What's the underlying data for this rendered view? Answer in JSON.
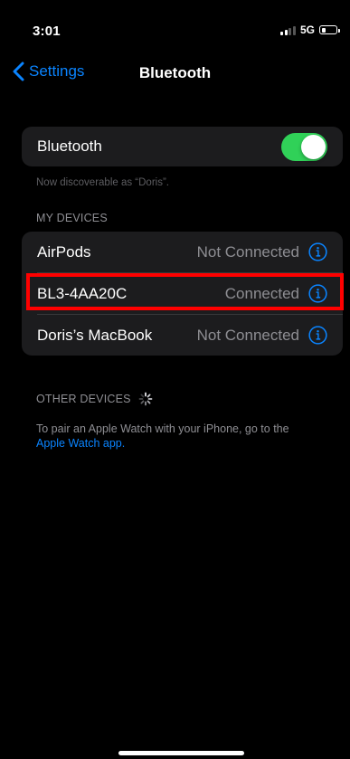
{
  "status_bar": {
    "time": "3:01",
    "network": "5G",
    "battery_level": 0.35
  },
  "nav": {
    "back_label": "Settings",
    "title": "Bluetooth"
  },
  "bluetooth_toggle": {
    "label": "Bluetooth",
    "on": true
  },
  "discoverable_text": "Now discoverable as “Doris”.",
  "my_devices": {
    "header": "MY DEVICES",
    "devices": [
      {
        "name": "AirPods",
        "status": "Not Connected"
      },
      {
        "name": "BL3-4AA20C",
        "status": "Connected"
      },
      {
        "name": "Doris’s MacBook",
        "status": "Not Connected"
      }
    ]
  },
  "other_devices": {
    "header": "OTHER DEVICES",
    "pair_text": "To pair an Apple Watch with your iPhone, go to the",
    "pair_link": "Apple Watch app."
  },
  "colors": {
    "accent": "#0a84ff",
    "toggle_on": "#30d158",
    "highlight": "#ff0000"
  }
}
